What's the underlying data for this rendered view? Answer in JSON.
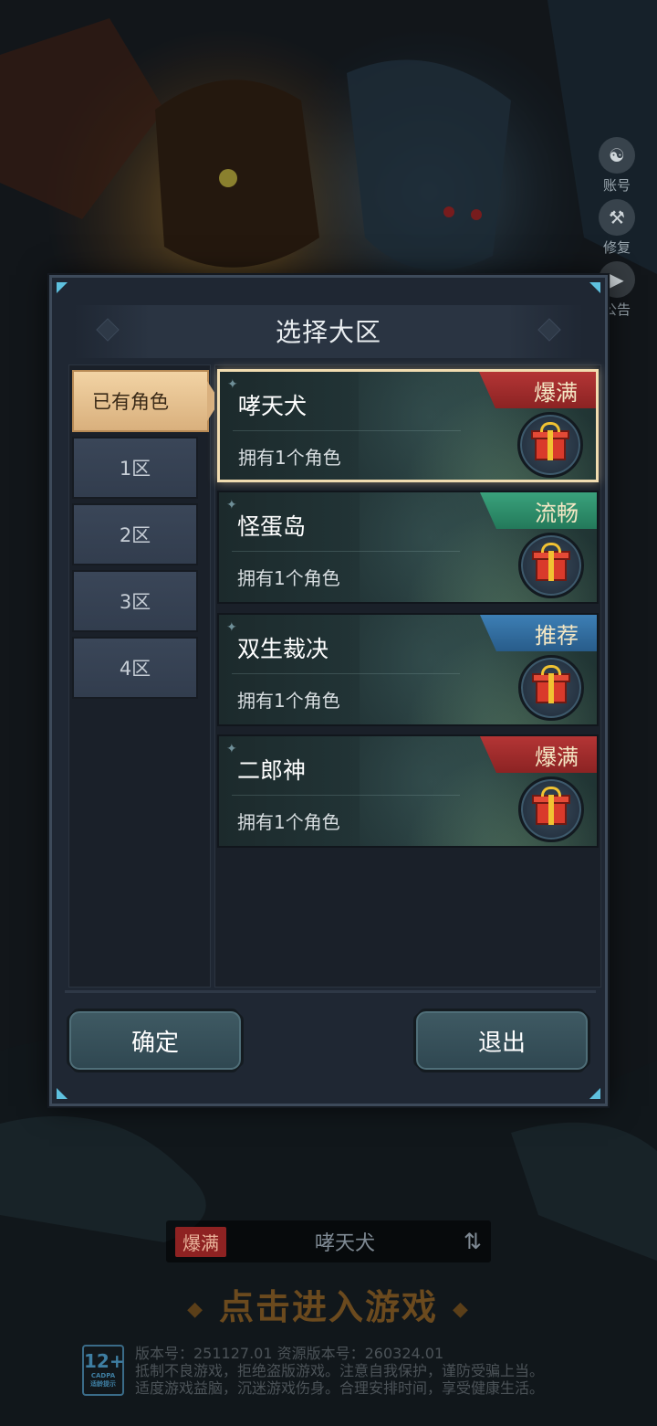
{
  "side_menu": [
    {
      "label": "账号",
      "icon": "account-icon"
    },
    {
      "label": "修复",
      "icon": "wrench-icon"
    },
    {
      "label": "公告",
      "icon": "speaker-icon"
    }
  ],
  "modal": {
    "title": "选择大区",
    "tabs": [
      {
        "label": "已有角色",
        "active": true
      },
      {
        "label": "1区"
      },
      {
        "label": "2区"
      },
      {
        "label": "3区"
      },
      {
        "label": "4区"
      }
    ],
    "servers": [
      {
        "name": "哮天犬",
        "roles": "拥有1个角色",
        "status": "爆满",
        "status_type": "full",
        "selected": true
      },
      {
        "name": "怪蛋岛",
        "roles": "拥有1个角色",
        "status": "流畅",
        "status_type": "smooth"
      },
      {
        "name": "双生裁决",
        "roles": "拥有1个角色",
        "status": "推荐",
        "status_type": "recommend"
      },
      {
        "name": "二郎神",
        "roles": "拥有1个角色",
        "status": "爆满",
        "status_type": "full"
      }
    ],
    "confirm_label": "确定",
    "exit_label": "退出"
  },
  "current_server": {
    "status": "爆满",
    "name": "哮天犬"
  },
  "enter_game_label": "点击进入游戏",
  "legal": {
    "age_rating": "12+",
    "age_org": "CADPA",
    "age_note": "适龄提示",
    "line1": "版本号：251127.01 资源版本号：260324.01",
    "line2": "抵制不良游戏，拒绝盗版游戏。注意自我保护，谨防受骗上当。",
    "line3": "适度游戏益脑，沉迷游戏伤身。合理安排时间，享受健康生活。"
  },
  "colors": {
    "status_full": "#b43535",
    "status_smooth": "#3aa27c",
    "status_recommend": "#3d7fb5",
    "active_tab": "#e8c593",
    "selected_border": "#f1dcb0"
  }
}
